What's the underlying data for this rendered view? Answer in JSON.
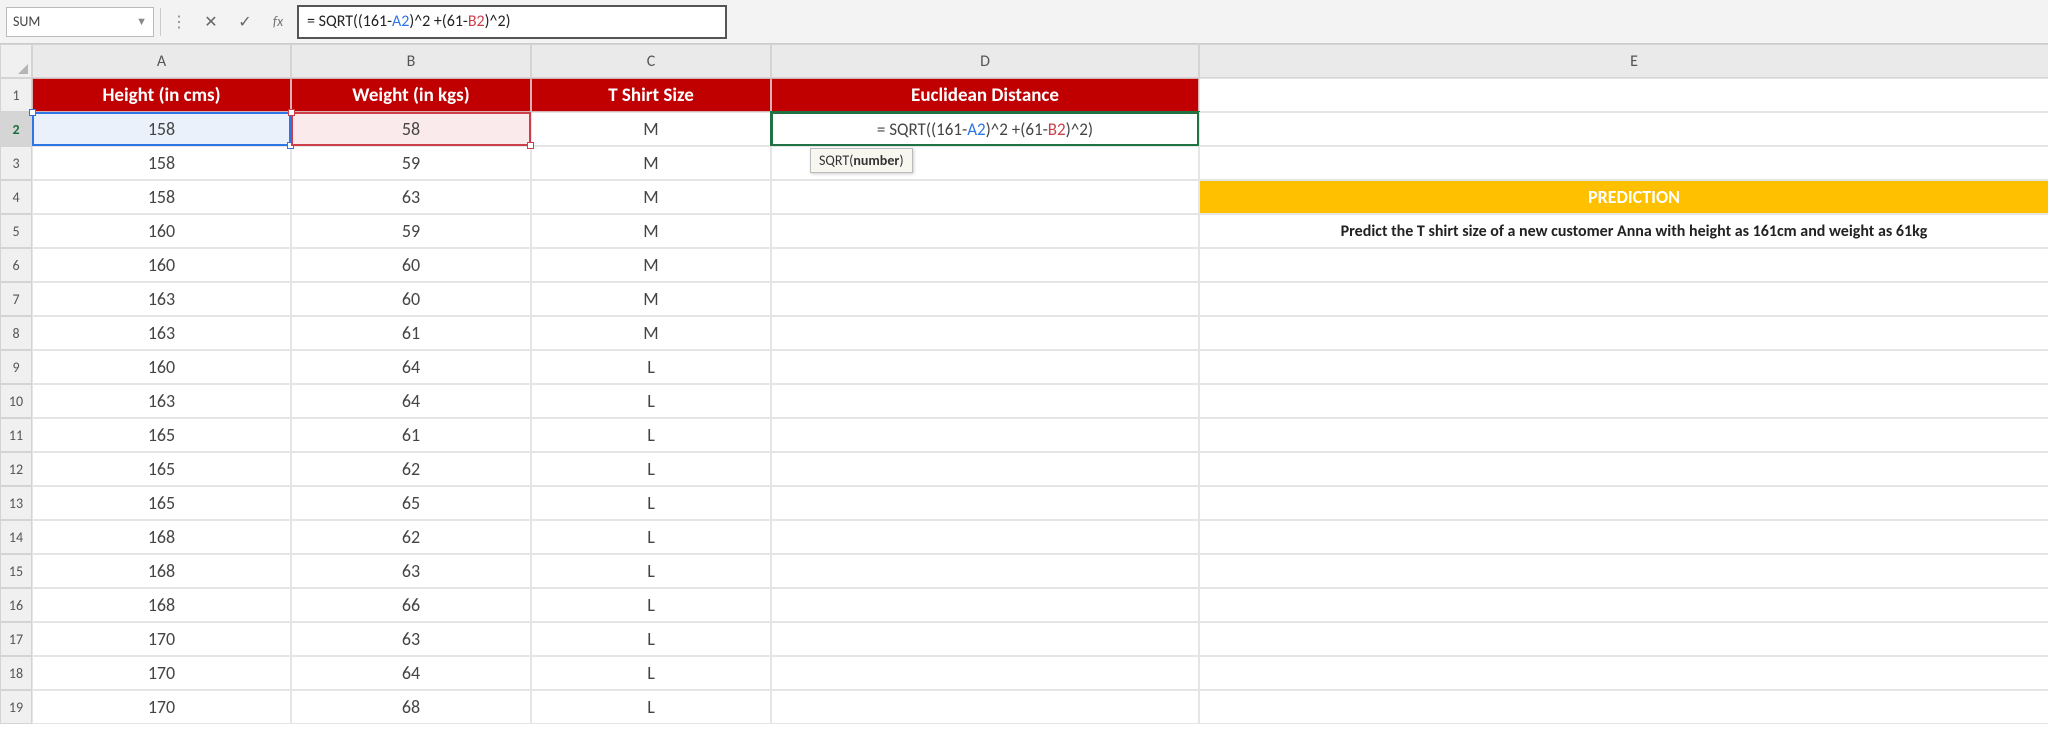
{
  "namebox": {
    "value": "SUM"
  },
  "formula_bar": {
    "pre": "= SQRT((161-",
    "refA": "A2",
    "mid1": ")^2 +(61-",
    "refB": "B2",
    "post": ")^2)"
  },
  "tooltip": {
    "fn": "SQRT",
    "arg": "number"
  },
  "columns": [
    "A",
    "B",
    "C",
    "D",
    "E"
  ],
  "headers": {
    "A": "Height (in cms)",
    "B": "Weight (in kgs)",
    "C": "T Shirt Size",
    "D": "Euclidean Distance"
  },
  "prediction_header": "PREDICTION",
  "prediction_text": "Predict the T shirt size of a new customer Anna with height as 161cm and weight as 61kg",
  "rows": [
    {
      "n": 1
    },
    {
      "n": 2,
      "A": "158",
      "B": "58",
      "C": "M"
    },
    {
      "n": 3,
      "A": "158",
      "B": "59",
      "C": "M"
    },
    {
      "n": 4,
      "A": "158",
      "B": "63",
      "C": "M"
    },
    {
      "n": 5,
      "A": "160",
      "B": "59",
      "C": "M"
    },
    {
      "n": 6,
      "A": "160",
      "B": "60",
      "C": "M"
    },
    {
      "n": 7,
      "A": "163",
      "B": "60",
      "C": "M"
    },
    {
      "n": 8,
      "A": "163",
      "B": "61",
      "C": "M"
    },
    {
      "n": 9,
      "A": "160",
      "B": "64",
      "C": "L"
    },
    {
      "n": 10,
      "A": "163",
      "B": "64",
      "C": "L"
    },
    {
      "n": 11,
      "A": "165",
      "B": "61",
      "C": "L"
    },
    {
      "n": 12,
      "A": "165",
      "B": "62",
      "C": "L"
    },
    {
      "n": 13,
      "A": "165",
      "B": "65",
      "C": "L"
    },
    {
      "n": 14,
      "A": "168",
      "B": "62",
      "C": "L"
    },
    {
      "n": 15,
      "A": "168",
      "B": "63",
      "C": "L"
    },
    {
      "n": 16,
      "A": "168",
      "B": "66",
      "C": "L"
    },
    {
      "n": 17,
      "A": "170",
      "B": "63",
      "C": "L"
    },
    {
      "n": 18,
      "A": "170",
      "B": "64",
      "C": "L"
    },
    {
      "n": 19,
      "A": "170",
      "B": "68",
      "C": "L"
    }
  ],
  "chart_data": {
    "type": "table",
    "title": "Height / Weight / T-Shirt Size training data with Euclidean distance to (161, 61)",
    "columns": [
      "Height (in cms)",
      "Weight (in kgs)",
      "T Shirt Size"
    ],
    "rows": [
      [
        158,
        58,
        "M"
      ],
      [
        158,
        59,
        "M"
      ],
      [
        158,
        63,
        "M"
      ],
      [
        160,
        59,
        "M"
      ],
      [
        160,
        60,
        "M"
      ],
      [
        163,
        60,
        "M"
      ],
      [
        163,
        61,
        "M"
      ],
      [
        160,
        64,
        "L"
      ],
      [
        163,
        64,
        "L"
      ],
      [
        165,
        61,
        "L"
      ],
      [
        165,
        62,
        "L"
      ],
      [
        165,
        65,
        "L"
      ],
      [
        168,
        62,
        "L"
      ],
      [
        168,
        63,
        "L"
      ],
      [
        168,
        66,
        "L"
      ],
      [
        170,
        63,
        "L"
      ],
      [
        170,
        64,
        "L"
      ],
      [
        170,
        68,
        "L"
      ]
    ],
    "query_point": {
      "height": 161,
      "weight": 61
    },
    "formula": "= SQRT((161-A2)^2 +(61-B2)^2)"
  }
}
